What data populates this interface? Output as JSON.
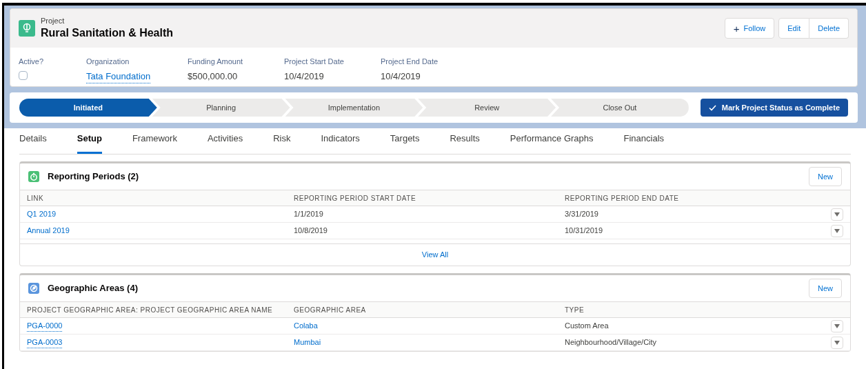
{
  "record": {
    "type_label": "Project",
    "title": "Rural Sanitation & Health",
    "actions": [
      {
        "kind": "follow",
        "label": "Follow",
        "icon_text": "+"
      },
      {
        "kind": "group",
        "label": "Edit"
      },
      {
        "kind": "group",
        "label": "Delete"
      }
    ],
    "fields": [
      {
        "label": "Active?",
        "kind": "checkbox",
        "checked": false
      },
      {
        "label": "Organization",
        "kind": "link",
        "value": "Tata Foundation"
      },
      {
        "label": "Funding Amount",
        "kind": "text",
        "value": "$500,000.00"
      },
      {
        "label": "Project Start Date",
        "kind": "text",
        "value": "10/4/2019"
      },
      {
        "label": "Project End Date",
        "kind": "text",
        "value": "10/4/2019"
      }
    ]
  },
  "path": {
    "steps": [
      {
        "label": "Initiated",
        "selected": true
      },
      {
        "label": "Planning",
        "selected": false
      },
      {
        "label": "Implementation",
        "selected": false
      },
      {
        "label": "Review",
        "selected": false
      },
      {
        "label": "Close Out",
        "selected": false
      }
    ],
    "button": "Mark Project Status as Complete"
  },
  "tabs": [
    {
      "label": "Details",
      "selected": false
    },
    {
      "label": "Setup",
      "selected": true
    },
    {
      "label": "Framework",
      "selected": false
    },
    {
      "label": "Activities",
      "selected": false
    },
    {
      "label": "Risk",
      "selected": false
    },
    {
      "label": "Indicators",
      "selected": false
    },
    {
      "label": "Targets",
      "selected": false
    },
    {
      "label": "Results",
      "selected": false
    },
    {
      "label": "Performance Graphs",
      "selected": false
    },
    {
      "label": "Financials",
      "selected": false
    }
  ],
  "related_lists": [
    {
      "title": "Reporting Periods (2)",
      "color": "#4bc076",
      "new_button": "New",
      "columns": [
        "LINK",
        "REPORTING PERIOD START DATE",
        "REPORTING PERIOD END DATE"
      ],
      "rows": [
        [
          {
            "kind": "link",
            "text": "Q1 2019"
          },
          {
            "kind": "text",
            "text": "1/1/2019"
          },
          {
            "kind": "text",
            "text": "3/31/2019"
          }
        ],
        [
          {
            "kind": "link",
            "text": "Annual 2019"
          },
          {
            "kind": "text",
            "text": "10/8/2019"
          },
          {
            "kind": "text",
            "text": "10/31/2019"
          }
        ]
      ],
      "footer_link": "View All"
    },
    {
      "title": "Geographic Areas (4)",
      "color": "#5a95dd",
      "new_button": "New",
      "columns": [
        "PROJECT GEOGRAPHIC AREA: PROJECT GEOGRAPHIC AREA NAME",
        "GEOGRAPHIC AREA",
        "TYPE"
      ],
      "rows": [
        [
          {
            "kind": "link",
            "text": "PGA-0000"
          },
          {
            "kind": "link",
            "text": "Colaba"
          },
          {
            "kind": "text",
            "text": "Custom Area"
          }
        ],
        [
          {
            "kind": "link",
            "text": "PGA-0003"
          },
          {
            "kind": "link",
            "text": "Mumbai"
          },
          {
            "kind": "text",
            "text": "Neighbourhood/Village/City"
          }
        ]
      ]
    }
  ]
}
